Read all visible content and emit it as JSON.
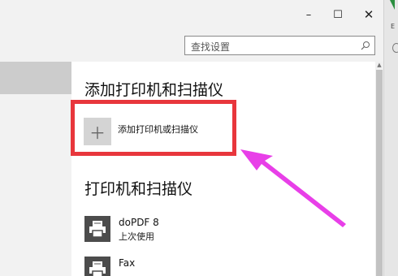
{
  "window": {
    "minimize_glyph": "–",
    "maximize_glyph": "☐",
    "close_glyph": "✕"
  },
  "search": {
    "placeholder": "查找设置",
    "icon": "search-icon"
  },
  "section_add": {
    "heading": "添加打印机和扫描仪",
    "button_label": "添加打印机或扫描仪",
    "button_icon": "plus-icon"
  },
  "section_printers": {
    "heading": "打印机和扫描仪",
    "items": [
      {
        "name": "doPDF 8",
        "status": "上次使用",
        "icon": "printer-icon"
      },
      {
        "name": "Fax",
        "status": "",
        "icon": "printer-icon"
      }
    ]
  },
  "colors": {
    "highlight": "#e8363c",
    "arrow": "#e83fe8",
    "chrome": "#f2f2f2",
    "nav_selected": "#cccccc",
    "printer_tile": "#4c4c4c"
  },
  "edge_char": "E"
}
